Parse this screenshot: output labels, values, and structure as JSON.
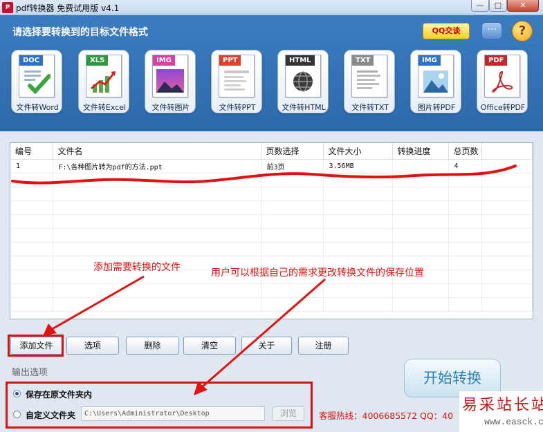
{
  "window": {
    "title": "pdf转换器 免费试用版 v4.1",
    "app_icon": "pdf-icon",
    "minimize": "—",
    "maximize": "□",
    "close": "✕"
  },
  "header": {
    "title": "请选择要转换到的目标文件格式",
    "qq_label": "QQ交谈",
    "chat_icon": "···",
    "help_icon": "?"
  },
  "formats": [
    {
      "tag": "DOC",
      "label": "文件转Word",
      "tag_color": "#2a73c7"
    },
    {
      "tag": "XLS",
      "label": "文件转Excel",
      "tag_color": "#2e9a3e"
    },
    {
      "tag": "IMG",
      "label": "文件转图片",
      "tag_color": "#d93ea0"
    },
    {
      "tag": "PPT",
      "label": "文件转PPT",
      "tag_color": "#d8452a"
    },
    {
      "tag": "HTML",
      "label": "文件转HTML",
      "tag_color": "#333333"
    },
    {
      "tag": "TXT",
      "label": "文件转TXT",
      "tag_color": "#8a8a8a"
    },
    {
      "tag": "IMG",
      "label": "图片转PDF",
      "tag_color": "#2a73c7"
    },
    {
      "tag": "PDF",
      "label": "Office转PDF",
      "tag_color": "#c0282a"
    }
  ],
  "table": {
    "columns": [
      "编号",
      "文件名",
      "页数选择",
      "文件大小",
      "转换进度",
      "总页数",
      ""
    ],
    "rows": [
      [
        "1",
        "F:\\各种图片转为pdf的方法.ppt",
        "前3页",
        "3.56MB",
        "",
        "4",
        ""
      ]
    ]
  },
  "buttons": {
    "add": "添加文件",
    "options": "选项",
    "delete": "删除",
    "clear": "清空",
    "about": "关于",
    "register": "注册",
    "start": "开始转换"
  },
  "output": {
    "title": "输出选项",
    "option_same": "保存在原文件夹内",
    "option_custom": "自定义文件夹",
    "path": "C:\\Users\\Administrator\\Desktop",
    "browse": "浏览",
    "selected": "option_same"
  },
  "footer": {
    "hotline": "客服热线：4006685572 QQ：40"
  },
  "watermark": {
    "line1": "易采站长站",
    "line2": "www.easck.com"
  },
  "annotations": {
    "add_note": "添加需要转换的文件",
    "path_note": "用户可以根据自己的需求更改转换文件的保存位置",
    "color": "#e01010"
  }
}
